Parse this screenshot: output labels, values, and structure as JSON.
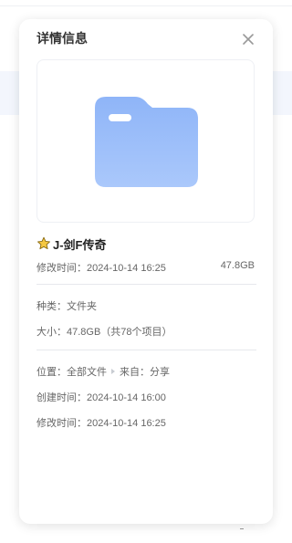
{
  "panel": {
    "title": "详情信息"
  },
  "file": {
    "name": "J-剑F传奇",
    "modified_inline": "修改时间：2024-10-14 16:25",
    "size_short": "47.8GB"
  },
  "details": {
    "type_label": "种类：",
    "type_value": "文件夹",
    "size_label": "大小：",
    "size_value": "47.8GB（共78个项目）"
  },
  "location": {
    "label": "位置：",
    "path": "全部文件",
    "from_label": "来自：",
    "from_value": "分享"
  },
  "times": {
    "created": "创建时间：2024-10-14 16:00",
    "modified": "修改时间：2024-10-14 16:25"
  },
  "icons": {
    "close": "close-icon",
    "folder": "folder-icon",
    "star": "star-icon"
  },
  "colors": {
    "folder_top": "#8fb5f8",
    "folder_bottom": "#a8c7fb",
    "star_fill": "#f5c842"
  }
}
